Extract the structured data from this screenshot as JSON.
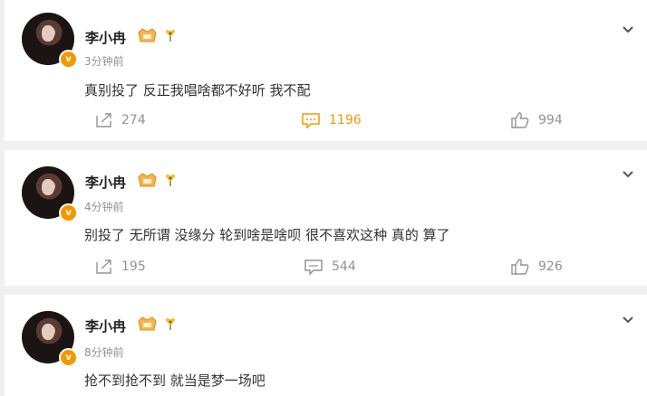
{
  "posts": [
    {
      "username": "李小冉",
      "time": "3分钟前",
      "content": "真别投了 反正我唱啥都不好听 我不配",
      "reposts": "274",
      "comments": "1196",
      "likes": "994",
      "comments_active": true
    },
    {
      "username": "李小冉",
      "time": "4分钟前",
      "content": "别投了 无所谓 没缘分 轮到啥是啥呗 很不喜欢这种 真的  算了",
      "reposts": "195",
      "comments": "544",
      "likes": "926",
      "comments_active": false
    },
    {
      "username": "李小冉",
      "time": "8分钟前",
      "content": "抢不到抢不到 就当是梦一场吧"
    }
  ],
  "colors": {
    "accent": "#f39800",
    "muted": "#939393",
    "text": "#333333"
  },
  "icons": {
    "repost": "repost-icon",
    "comment": "comment-icon",
    "like": "like-icon",
    "menu": "chevron-down-icon",
    "verified": "verified-badge-icon"
  }
}
